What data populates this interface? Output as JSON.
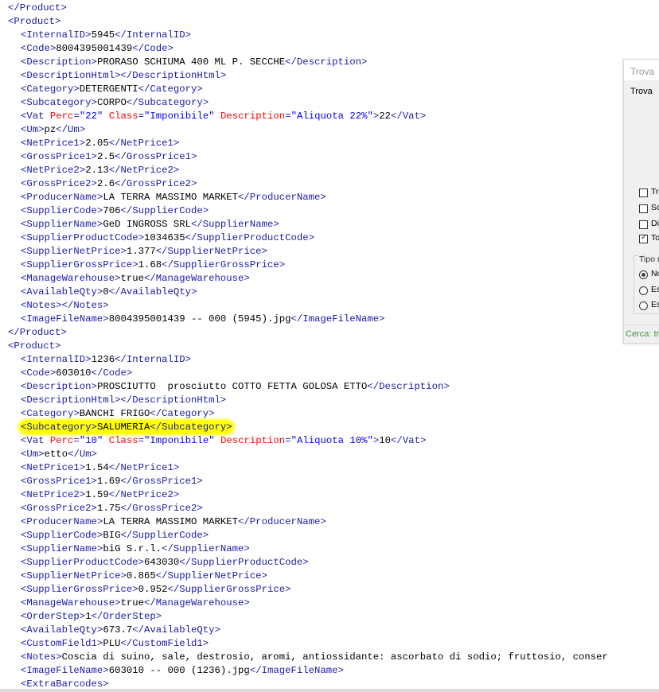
{
  "editor": {
    "lines": [
      {
        "indent": "",
        "segs": [
          {
            "t": "tag",
            "v": "</Product>"
          }
        ]
      },
      {
        "indent": "",
        "segs": [
          {
            "t": "tag",
            "v": "<Product>"
          }
        ]
      },
      {
        "indent": "  ",
        "segs": [
          {
            "t": "tag",
            "v": "<InternalID>"
          },
          {
            "t": "txt",
            "v": "5945"
          },
          {
            "t": "tag",
            "v": "</InternalID>"
          }
        ]
      },
      {
        "indent": "  ",
        "segs": [
          {
            "t": "tag",
            "v": "<Code>"
          },
          {
            "t": "txt",
            "v": "8004395001439"
          },
          {
            "t": "tag",
            "v": "</Code>"
          }
        ]
      },
      {
        "indent": "  ",
        "segs": [
          {
            "t": "tag",
            "v": "<Description>"
          },
          {
            "t": "txt",
            "v": "PRORASO SCHIUMA 400 ML P. SECCHE"
          },
          {
            "t": "tag",
            "v": "</Description>"
          }
        ]
      },
      {
        "indent": "  ",
        "segs": [
          {
            "t": "tag",
            "v": "<DescriptionHtml>"
          },
          {
            "t": "tag",
            "v": "</DescriptionHtml>"
          }
        ]
      },
      {
        "indent": "  ",
        "segs": [
          {
            "t": "tag",
            "v": "<Category>"
          },
          {
            "t": "txt",
            "v": "DETERGENTI"
          },
          {
            "t": "tag",
            "v": "</Category>"
          }
        ]
      },
      {
        "indent": "  ",
        "segs": [
          {
            "t": "tag",
            "v": "<Subcategory>"
          },
          {
            "t": "txt",
            "v": "CORPO"
          },
          {
            "t": "tag",
            "v": "</Subcategory>"
          }
        ]
      },
      {
        "indent": "  ",
        "segs": [
          {
            "t": "tag",
            "v": "<Vat "
          },
          {
            "t": "attr",
            "v": "Perc"
          },
          {
            "t": "tag",
            "v": "="
          },
          {
            "t": "val",
            "v": "\"22\""
          },
          {
            "t": "txt",
            "v": " "
          },
          {
            "t": "attr",
            "v": "Class"
          },
          {
            "t": "tag",
            "v": "="
          },
          {
            "t": "val",
            "v": "\"Imponibile\""
          },
          {
            "t": "txt",
            "v": " "
          },
          {
            "t": "attr",
            "v": "Description"
          },
          {
            "t": "tag",
            "v": "="
          },
          {
            "t": "val",
            "v": "\"Aliquota 22%\""
          },
          {
            "t": "tag",
            "v": ">"
          },
          {
            "t": "txt",
            "v": "22"
          },
          {
            "t": "tag",
            "v": "</Vat>"
          }
        ]
      },
      {
        "indent": "  ",
        "segs": [
          {
            "t": "tag",
            "v": "<Um>"
          },
          {
            "t": "txt",
            "v": "pz"
          },
          {
            "t": "tag",
            "v": "</Um>"
          }
        ]
      },
      {
        "indent": "  ",
        "segs": [
          {
            "t": "tag",
            "v": "<NetPrice1>"
          },
          {
            "t": "txt",
            "v": "2.05"
          },
          {
            "t": "tag",
            "v": "</NetPrice1>"
          }
        ]
      },
      {
        "indent": "  ",
        "segs": [
          {
            "t": "tag",
            "v": "<GrossPrice1>"
          },
          {
            "t": "txt",
            "v": "2.5"
          },
          {
            "t": "tag",
            "v": "</GrossPrice1>"
          }
        ]
      },
      {
        "indent": "  ",
        "segs": [
          {
            "t": "tag",
            "v": "<NetPrice2>"
          },
          {
            "t": "txt",
            "v": "2.13"
          },
          {
            "t": "tag",
            "v": "</NetPrice2>"
          }
        ]
      },
      {
        "indent": "  ",
        "segs": [
          {
            "t": "tag",
            "v": "<GrossPrice2>"
          },
          {
            "t": "txt",
            "v": "2.6"
          },
          {
            "t": "tag",
            "v": "</GrossPrice2>"
          }
        ]
      },
      {
        "indent": "  ",
        "segs": [
          {
            "t": "tag",
            "v": "<ProducerName>"
          },
          {
            "t": "txt",
            "v": "LA TERRA MASSIMO MARKET"
          },
          {
            "t": "tag",
            "v": "</ProducerName>"
          }
        ]
      },
      {
        "indent": "  ",
        "segs": [
          {
            "t": "tag",
            "v": "<SupplierCode>"
          },
          {
            "t": "txt",
            "v": "706"
          },
          {
            "t": "tag",
            "v": "</SupplierCode>"
          }
        ]
      },
      {
        "indent": "  ",
        "segs": [
          {
            "t": "tag",
            "v": "<SupplierName>"
          },
          {
            "t": "txt",
            "v": "GeD INGROSS SRL"
          },
          {
            "t": "tag",
            "v": "</SupplierName>"
          }
        ]
      },
      {
        "indent": "  ",
        "segs": [
          {
            "t": "tag",
            "v": "<SupplierProductCode>"
          },
          {
            "t": "txt",
            "v": "1034635"
          },
          {
            "t": "tag",
            "v": "</SupplierProductCode>"
          }
        ]
      },
      {
        "indent": "  ",
        "segs": [
          {
            "t": "tag",
            "v": "<SupplierNetPrice>"
          },
          {
            "t": "txt",
            "v": "1.377"
          },
          {
            "t": "tag",
            "v": "</SupplierNetPrice>"
          }
        ]
      },
      {
        "indent": "  ",
        "segs": [
          {
            "t": "tag",
            "v": "<SupplierGrossPrice>"
          },
          {
            "t": "txt",
            "v": "1.68"
          },
          {
            "t": "tag",
            "v": "</SupplierGrossPrice>"
          }
        ]
      },
      {
        "indent": "  ",
        "segs": [
          {
            "t": "tag",
            "v": "<ManageWarehouse>"
          },
          {
            "t": "txt",
            "v": "true"
          },
          {
            "t": "tag",
            "v": "</ManageWarehouse>"
          }
        ]
      },
      {
        "indent": "  ",
        "segs": [
          {
            "t": "tag",
            "v": "<AvailableQty>"
          },
          {
            "t": "txt",
            "v": "0"
          },
          {
            "t": "tag",
            "v": "</AvailableQty>"
          }
        ]
      },
      {
        "indent": "  ",
        "segs": [
          {
            "t": "tag",
            "v": "<Notes>"
          },
          {
            "t": "tag",
            "v": "</Notes>"
          }
        ]
      },
      {
        "indent": "  ",
        "segs": [
          {
            "t": "tag",
            "v": "<ImageFileName>"
          },
          {
            "t": "txt",
            "v": "8004395001439 -- 000 (5945).jpg"
          },
          {
            "t": "tag",
            "v": "</ImageFileName>"
          }
        ]
      },
      {
        "indent": "",
        "segs": [
          {
            "t": "tag",
            "v": "</Product>"
          }
        ]
      },
      {
        "indent": "",
        "segs": [
          {
            "t": "tag",
            "v": "<Product>"
          }
        ]
      },
      {
        "indent": "  ",
        "segs": [
          {
            "t": "tag",
            "v": "<InternalID>"
          },
          {
            "t": "txt",
            "v": "1236"
          },
          {
            "t": "tag",
            "v": "</InternalID>"
          }
        ]
      },
      {
        "indent": "  ",
        "segs": [
          {
            "t": "tag",
            "v": "<Code>"
          },
          {
            "t": "txt",
            "v": "603010"
          },
          {
            "t": "tag",
            "v": "</Code>"
          }
        ]
      },
      {
        "indent": "  ",
        "segs": [
          {
            "t": "tag",
            "v": "<Description>"
          },
          {
            "t": "txt",
            "v": "PROSCIUTTO  prosciutto COTTO FETTA GOLOSA ETTO"
          },
          {
            "t": "tag",
            "v": "</Description>"
          }
        ]
      },
      {
        "indent": "  ",
        "segs": [
          {
            "t": "tag",
            "v": "<DescriptionHtml>"
          },
          {
            "t": "tag",
            "v": "</DescriptionHtml>"
          }
        ]
      },
      {
        "indent": "  ",
        "segs": [
          {
            "t": "tag",
            "v": "<Category>"
          },
          {
            "t": "txt",
            "v": "BANCHI FRIGO"
          },
          {
            "t": "tag",
            "v": "</Category>"
          }
        ]
      },
      {
        "indent": "  ",
        "highlight": true,
        "segs": [
          {
            "t": "tag",
            "v": "<Subcategory>"
          },
          {
            "t": "txt",
            "v": "SALUMERIA"
          },
          {
            "t": "tag",
            "v": "</Subcategory>"
          }
        ]
      },
      {
        "indent": "  ",
        "segs": [
          {
            "t": "tag",
            "v": "<Vat "
          },
          {
            "t": "attr",
            "v": "Perc"
          },
          {
            "t": "tag",
            "v": "="
          },
          {
            "t": "val",
            "v": "\"10\""
          },
          {
            "t": "txt",
            "v": " "
          },
          {
            "t": "attr",
            "v": "Class"
          },
          {
            "t": "tag",
            "v": "="
          },
          {
            "t": "val",
            "v": "\"Imponibile\""
          },
          {
            "t": "txt",
            "v": " "
          },
          {
            "t": "attr",
            "v": "Description"
          },
          {
            "t": "tag",
            "v": "="
          },
          {
            "t": "val",
            "v": "\"Aliquota 10%\""
          },
          {
            "t": "tag",
            "v": ">"
          },
          {
            "t": "txt",
            "v": "10"
          },
          {
            "t": "tag",
            "v": "</Vat>"
          }
        ]
      },
      {
        "indent": "  ",
        "segs": [
          {
            "t": "tag",
            "v": "<Um>"
          },
          {
            "t": "txt",
            "v": "etto"
          },
          {
            "t": "tag",
            "v": "</Um>"
          }
        ]
      },
      {
        "indent": "  ",
        "segs": [
          {
            "t": "tag",
            "v": "<NetPrice1>"
          },
          {
            "t": "txt",
            "v": "1.54"
          },
          {
            "t": "tag",
            "v": "</NetPrice1>"
          }
        ]
      },
      {
        "indent": "  ",
        "segs": [
          {
            "t": "tag",
            "v": "<GrossPrice1>"
          },
          {
            "t": "txt",
            "v": "1.69"
          },
          {
            "t": "tag",
            "v": "</GrossPrice1>"
          }
        ]
      },
      {
        "indent": "  ",
        "segs": [
          {
            "t": "tag",
            "v": "<NetPrice2>"
          },
          {
            "t": "txt",
            "v": "1.59"
          },
          {
            "t": "tag",
            "v": "</NetPrice2>"
          }
        ]
      },
      {
        "indent": "  ",
        "segs": [
          {
            "t": "tag",
            "v": "<GrossPrice2>"
          },
          {
            "t": "txt",
            "v": "1.75"
          },
          {
            "t": "tag",
            "v": "</GrossPrice2>"
          }
        ]
      },
      {
        "indent": "  ",
        "segs": [
          {
            "t": "tag",
            "v": "<ProducerName>"
          },
          {
            "t": "txt",
            "v": "LA TERRA MASSIMO MARKET"
          },
          {
            "t": "tag",
            "v": "</ProducerName>"
          }
        ]
      },
      {
        "indent": "  ",
        "segs": [
          {
            "t": "tag",
            "v": "<SupplierCode>"
          },
          {
            "t": "txt",
            "v": "BIG"
          },
          {
            "t": "tag",
            "v": "</SupplierCode>"
          }
        ]
      },
      {
        "indent": "  ",
        "segs": [
          {
            "t": "tag",
            "v": "<SupplierName>"
          },
          {
            "t": "txt",
            "v": "biG S.r.l."
          },
          {
            "t": "tag",
            "v": "</SupplierName>"
          }
        ]
      },
      {
        "indent": "  ",
        "segs": [
          {
            "t": "tag",
            "v": "<SupplierProductCode>"
          },
          {
            "t": "txt",
            "v": "643030"
          },
          {
            "t": "tag",
            "v": "</SupplierProductCode>"
          }
        ]
      },
      {
        "indent": "  ",
        "segs": [
          {
            "t": "tag",
            "v": "<SupplierNetPrice>"
          },
          {
            "t": "txt",
            "v": "0.865"
          },
          {
            "t": "tag",
            "v": "</SupplierNetPrice>"
          }
        ]
      },
      {
        "indent": "  ",
        "segs": [
          {
            "t": "tag",
            "v": "<SupplierGrossPrice>"
          },
          {
            "t": "txt",
            "v": "0.952"
          },
          {
            "t": "tag",
            "v": "</SupplierGrossPrice>"
          }
        ]
      },
      {
        "indent": "  ",
        "segs": [
          {
            "t": "tag",
            "v": "<ManageWarehouse>"
          },
          {
            "t": "txt",
            "v": "true"
          },
          {
            "t": "tag",
            "v": "</ManageWarehouse>"
          }
        ]
      },
      {
        "indent": "  ",
        "segs": [
          {
            "t": "tag",
            "v": "<OrderStep>"
          },
          {
            "t": "txt",
            "v": "1"
          },
          {
            "t": "tag",
            "v": "</OrderStep>"
          }
        ]
      },
      {
        "indent": "  ",
        "segs": [
          {
            "t": "tag",
            "v": "<AvailableQty>"
          },
          {
            "t": "txt",
            "v": "673.7"
          },
          {
            "t": "tag",
            "v": "</AvailableQty>"
          }
        ]
      },
      {
        "indent": "  ",
        "segs": [
          {
            "t": "tag",
            "v": "<CustomField1>"
          },
          {
            "t": "txt",
            "v": "PLU"
          },
          {
            "t": "tag",
            "v": "</CustomField1>"
          }
        ]
      },
      {
        "indent": "  ",
        "segs": [
          {
            "t": "tag",
            "v": "<Notes>"
          },
          {
            "t": "txt",
            "v": "Coscia di suino, sale, destrosio, aromi, antiossidante: ascorbato di sodio; fruttosio, conser"
          }
        ]
      },
      {
        "indent": "  ",
        "segs": [
          {
            "t": "tag",
            "v": "<ImageFileName>"
          },
          {
            "t": "txt",
            "v": "603010 -- 000 (1236).jpg"
          },
          {
            "t": "tag",
            "v": "</ImageFileName>"
          }
        ]
      },
      {
        "indent": "  ",
        "segs": [
          {
            "t": "tag",
            "v": "<ExtraBarcodes>"
          }
        ]
      }
    ]
  },
  "find_panel": {
    "title": "Trova",
    "tab_label": "Trova",
    "options": [
      {
        "label": "Tr",
        "checked": false
      },
      {
        "label": "Sc",
        "checked": false
      },
      {
        "label": "Dis",
        "checked": false
      },
      {
        "label": "To",
        "checked": true
      }
    ],
    "search_type_label": "Tipo r",
    "search_types": [
      {
        "label": "No",
        "selected": true
      },
      {
        "label": "Es",
        "selected": false
      },
      {
        "label": "Es",
        "selected": false
      }
    ],
    "status": "Cerca: tr"
  },
  "colors": {
    "tag": "#1a1aa6",
    "attr": "#ff0000",
    "value": "#0000ff",
    "text": "#000000",
    "highlight": "#ffff00",
    "status_text": "#3c9a3c"
  }
}
